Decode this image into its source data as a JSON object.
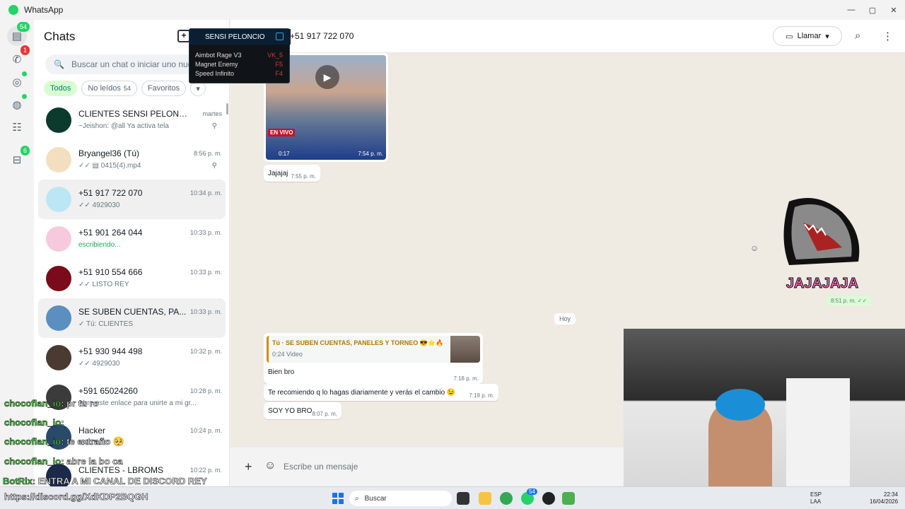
{
  "window": {
    "title": "WhatsApp",
    "minimize": "—",
    "maximize": "▢",
    "close": "✕"
  },
  "rail": {
    "chats_badge": "54",
    "calls_badge": "1",
    "archived_badge": "6"
  },
  "sidebar": {
    "title": "Chats",
    "search_placeholder": "Buscar un chat o iniciar uno nuevo",
    "filters": [
      {
        "label": "Todos",
        "count": ""
      },
      {
        "label": "No leídos",
        "count": "54"
      },
      {
        "label": "Favoritos",
        "count": ""
      }
    ],
    "filters_more": "▾",
    "chats": [
      {
        "name": "CLIENTES SENSI PELONCIO ...",
        "time": "martes",
        "preview": "~Jeishon: @all  Ya activa tela",
        "pinned": true,
        "avatar_color": "#0c3b2e"
      },
      {
        "name": "Bryangel36 (Tú)",
        "time": "8:56 p. m.",
        "preview": "✓✓ ▤ 0415(4).mp4",
        "pinned": true,
        "avatar_color": "#f3dfbf"
      },
      {
        "name": "+51 917 722 070",
        "time": "10:34 p. m.",
        "preview": "✓✓ 4929030",
        "pinned": false,
        "avatar_color": "#bde6f4"
      },
      {
        "name": "+51 901 264 044",
        "time": "10:33 p. m.",
        "preview": "escribiendo...",
        "pinned": false,
        "avatar_color": "#f7c9dd"
      },
      {
        "name": "+51 910 554 666",
        "time": "10:33 p. m.",
        "preview": "✓✓ LISTO REY",
        "pinned": false,
        "avatar_color": "#7a0b1a"
      },
      {
        "name": "SE SUBEN CUENTAS, PA...",
        "time": "10:33 p. m.",
        "preview": "✓ Tú: CLIENTES",
        "pinned": false,
        "avatar_color": "#5a8fbf"
      },
      {
        "name": "+51 930 944 498",
        "time": "10:32 p. m.",
        "preview": "✓✓ 4929030",
        "pinned": false,
        "avatar_color": "#4a3a30"
      },
      {
        "name": "+591 65024260",
        "time": "10:28 p. m.",
        "preview": "Abre este enlace para unirte a mi gr...",
        "pinned": false,
        "avatar_color": "#3b3b3b"
      },
      {
        "name": "Hacker",
        "time": "10:24 p. m.",
        "preview": "te extraño",
        "pinned": false,
        "avatar_color": "#2a4a6a"
      },
      {
        "name": "CLIENTES - LBROMS",
        "time": "10:22 p. m.",
        "preview": "",
        "pinned": false,
        "avatar_color": "#1b2a4a"
      }
    ]
  },
  "header": {
    "contact": "+51 917 722 070",
    "call_label": "Llamar"
  },
  "conversation": {
    "video": {
      "duration": "0:17",
      "time": "7:54 p. m.",
      "overlay": "EN VIVO"
    },
    "msg1": {
      "text": "Jajajaj",
      "time": "7:55 p. m."
    },
    "sticker": {
      "text": "JAJAJAJA",
      "time": "8:51 p. m. ✓✓"
    },
    "day": "Hoy",
    "quote": {
      "title": "Tú · SE SUBEN CUENTAS, PANELES Y TORNEO 😎⭐🔥",
      "sub": "0:24 Video"
    },
    "msg2": {
      "text": "Bien bro",
      "time": "7:18 p. m."
    },
    "msg3": {
      "text": "Te recomiendo q lo hagas diariamente y verás el cambio 😉",
      "time": "7:18 p. m."
    },
    "msg4": {
      "text": "SOY YO BRO",
      "time": "8:07 p. m."
    }
  },
  "composer": {
    "placeholder": "Escribe un mensaje"
  },
  "cheat_menu": {
    "title": "SENSI PELONCIO",
    "items": [
      {
        "label": "Aimbot Rage V3",
        "key": "VK_5"
      },
      {
        "label": "Magnet Enemy",
        "key": "F5"
      },
      {
        "label": "Speed Infinito",
        "key": "F4"
      }
    ]
  },
  "stream_chat": [
    {
      "user": "chocoflan_io",
      "msg": ": pr tu ro"
    },
    {
      "user": "chocoflan_io",
      "msg": ":"
    },
    {
      "user": "chocoflan_io",
      "msg": ": te extraño 🥺"
    },
    {
      "user": "chocoflan_io",
      "msg": ": abre la bo ca"
    }
  ],
  "bot": {
    "name": "BotRix",
    "msg": ": ENTRA A MI CANAL DE DISCORD REY"
  },
  "discord_link": "https://discord.gg/XdKDP2BQGH",
  "taskbar": {
    "search": "Buscar",
    "whatsapp_badge": "54",
    "lang": "ESP",
    "lang2": "LAA",
    "time": "22:34",
    "date": "16/04/2026"
  }
}
